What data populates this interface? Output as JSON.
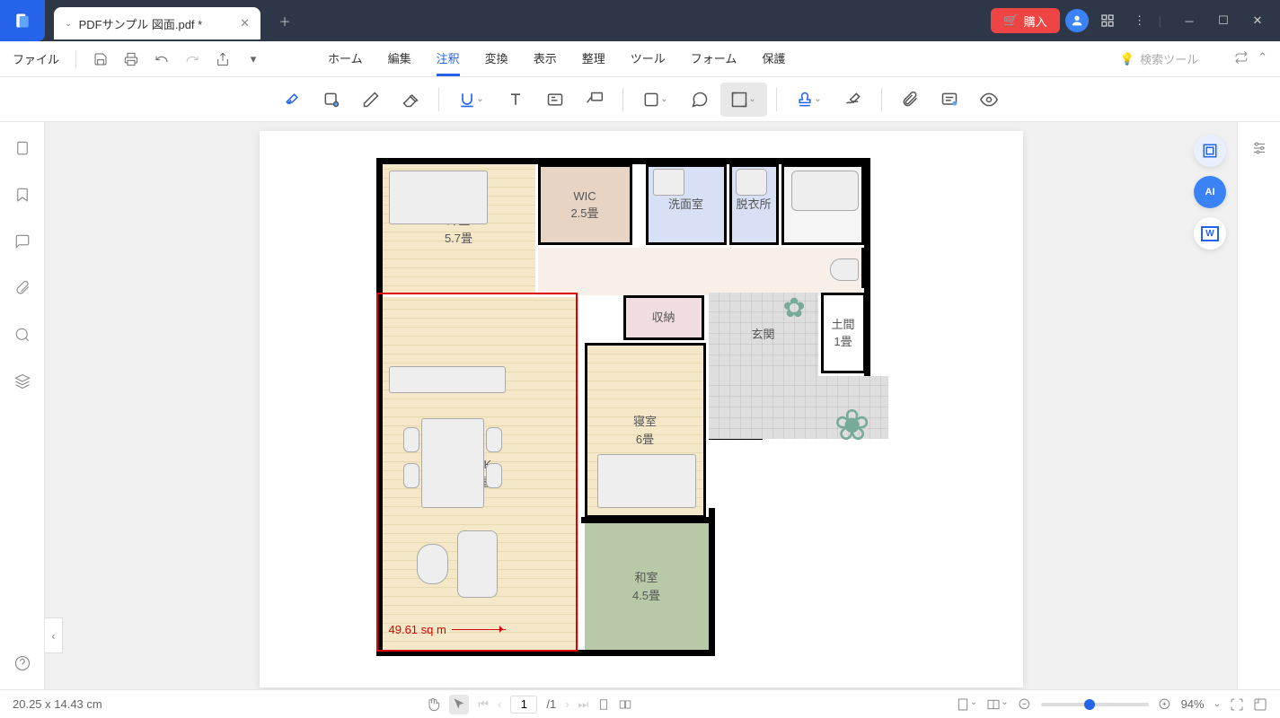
{
  "titlebar": {
    "filename": "PDFサンプル 図面.pdf *",
    "buy": "購入"
  },
  "menu": {
    "file": "ファイル",
    "tabs": [
      "ホーム",
      "編集",
      "注釈",
      "変換",
      "表示",
      "整理",
      "ツール",
      "フォーム",
      "保護"
    ],
    "activeTab": 2,
    "search": "検索ツール"
  },
  "status": {
    "dims": "20.25 x 14.43 cm",
    "page": "1",
    "total": "/1",
    "zoom": "94%"
  },
  "rooms": {
    "yoshitsu": {
      "name": "洋室",
      "size": "5.7畳"
    },
    "wic": {
      "name": "WIC",
      "size": "2.5畳"
    },
    "senmen": {
      "name": "洗面室"
    },
    "datsui": {
      "name": "脱衣所"
    },
    "yokushitsu": {
      "name": "浴室"
    },
    "wc": {
      "name": "WC"
    },
    "shuno": {
      "name": "収納"
    },
    "doma": {
      "name": "土間",
      "size": "1畳"
    },
    "genkan": {
      "name": "玄関"
    },
    "shinshitsu": {
      "name": "寝室",
      "size": "6畳"
    },
    "ldk": {
      "name": "LDK",
      "size": "18畳"
    },
    "washitsu": {
      "name": "和室",
      "size": "4.5畳"
    }
  },
  "measurement": "49.61 sq m"
}
